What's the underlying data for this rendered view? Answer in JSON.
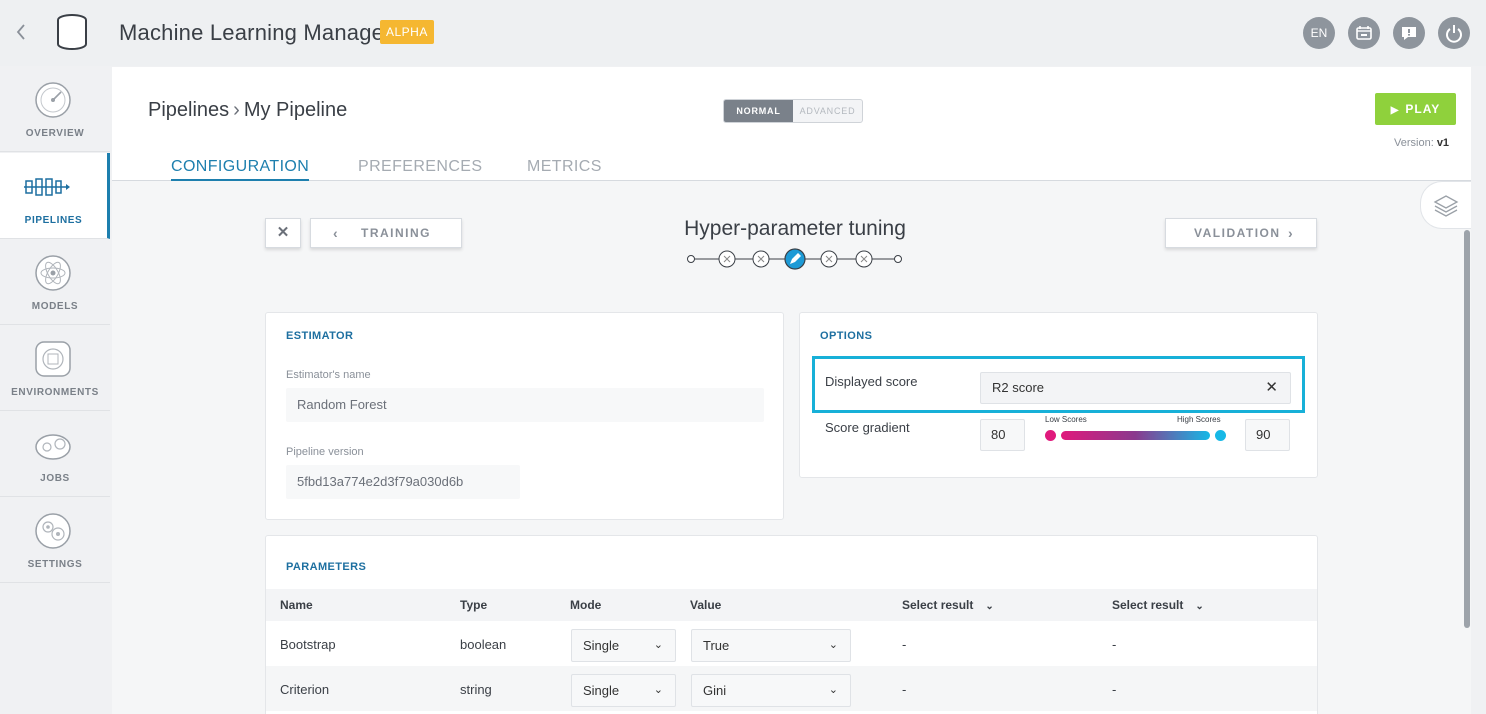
{
  "header": {
    "title": "Machine Learning Manager",
    "badge": "ALPHA",
    "lang": "EN"
  },
  "sidebar": {
    "items": [
      {
        "label": "OVERVIEW",
        "icon": "gauge-icon"
      },
      {
        "label": "PIPELINES",
        "icon": "pipeline-icon",
        "active": true
      },
      {
        "label": "MODELS",
        "icon": "atom-icon"
      },
      {
        "label": "ENVIRONMENTS",
        "icon": "environment-icon"
      },
      {
        "label": "JOBS",
        "icon": "cog-train-icon"
      },
      {
        "label": "SETTINGS",
        "icon": "gears-icon"
      }
    ]
  },
  "breadcrumb": {
    "root": "Pipelines",
    "current": "My Pipeline"
  },
  "mode": {
    "normal": "NORMAL",
    "advanced": "ADVANCED",
    "selected": "NORMAL"
  },
  "play": {
    "label": "PLAY"
  },
  "version": {
    "label": "Version:",
    "value": "v1"
  },
  "tabs": [
    "CONFIGURATION",
    "PREFERENCES",
    "METRICS"
  ],
  "step": {
    "title": "Hyper-parameter tuning",
    "prev_label": "TRAINING",
    "next_label": "VALIDATION",
    "current_step": 3,
    "total_steps": 6
  },
  "estimator": {
    "title": "ESTIMATOR",
    "name_label": "Estimator's name",
    "name_value": "Random Forest",
    "version_label": "Pipeline version",
    "version_value": "5fbd13a774e2d3f79a030d6b"
  },
  "options": {
    "title": "OPTIONS",
    "displayed_score_label": "Displayed score",
    "displayed_score_value": "R2 score",
    "gradient_label": "Score gradient",
    "gradient_min": "80",
    "gradient_max": "90",
    "low_label": "Low Scores",
    "high_label": "High Scores",
    "colors": {
      "low": "#e0197c",
      "high": "#17b8e6",
      "highlight": "#17b0d8"
    }
  },
  "parameters": {
    "title": "PARAMETERS",
    "columns": [
      "Name",
      "Type",
      "Mode",
      "Value",
      "Select result",
      "Select result"
    ],
    "rows": [
      {
        "name": "Bootstrap",
        "type": "boolean",
        "mode": "Single",
        "value": "True",
        "result1": "-",
        "result2": "-"
      },
      {
        "name": "Criterion",
        "type": "string",
        "mode": "Single",
        "value": "Gini",
        "result1": "-",
        "result2": "-"
      }
    ]
  }
}
